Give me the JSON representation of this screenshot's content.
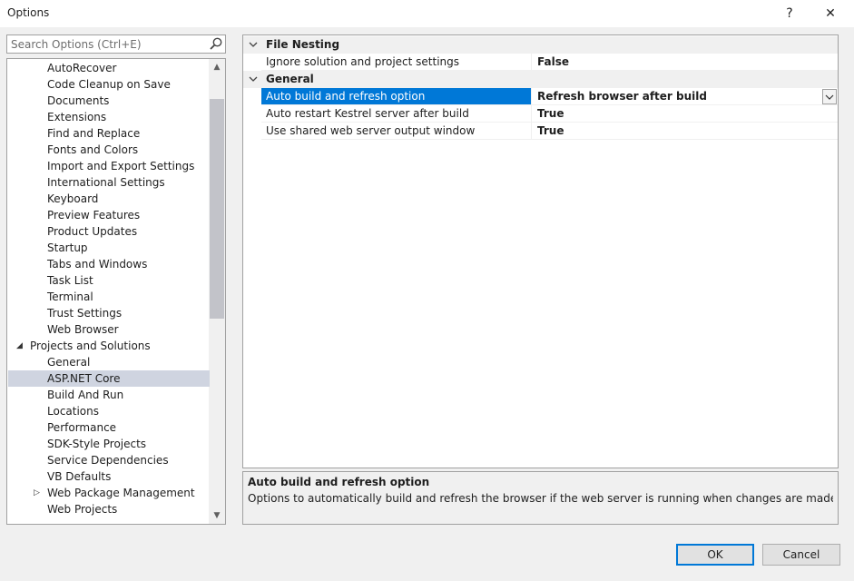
{
  "window": {
    "title": "Options",
    "help_label": "?",
    "close_label": "✕"
  },
  "search": {
    "placeholder": "Search Options (Ctrl+E)"
  },
  "tree": {
    "items": [
      {
        "label": "AutoRecover",
        "level": 2
      },
      {
        "label": "Code Cleanup on Save",
        "level": 2
      },
      {
        "label": "Documents",
        "level": 2
      },
      {
        "label": "Extensions",
        "level": 2
      },
      {
        "label": "Find and Replace",
        "level": 2
      },
      {
        "label": "Fonts and Colors",
        "level": 2
      },
      {
        "label": "Import and Export Settings",
        "level": 2
      },
      {
        "label": "International Settings",
        "level": 2
      },
      {
        "label": "Keyboard",
        "level": 2
      },
      {
        "label": "Preview Features",
        "level": 2
      },
      {
        "label": "Product Updates",
        "level": 2
      },
      {
        "label": "Startup",
        "level": 2
      },
      {
        "label": "Tabs and Windows",
        "level": 2
      },
      {
        "label": "Task List",
        "level": 2
      },
      {
        "label": "Terminal",
        "level": 2
      },
      {
        "label": "Trust Settings",
        "level": 2
      },
      {
        "label": "Web Browser",
        "level": 2
      },
      {
        "label": "Projects and Solutions",
        "level": 1,
        "expander": "◢"
      },
      {
        "label": "General",
        "level": 2
      },
      {
        "label": "ASP.NET Core",
        "level": 2,
        "selected": true
      },
      {
        "label": "Build And Run",
        "level": 2
      },
      {
        "label": "Locations",
        "level": 2
      },
      {
        "label": "Performance",
        "level": 2
      },
      {
        "label": "SDK-Style Projects",
        "level": 2
      },
      {
        "label": "Service Dependencies",
        "level": 2
      },
      {
        "label": "VB Defaults",
        "level": 2
      },
      {
        "label": "Web Package Management",
        "level": 2,
        "expander": "▷"
      },
      {
        "label": "Web Projects",
        "level": 2
      }
    ]
  },
  "grid": {
    "categories": [
      {
        "label": "File Nesting",
        "properties": [
          {
            "name": "Ignore solution and project settings",
            "value": "False"
          }
        ]
      },
      {
        "label": "General",
        "properties": [
          {
            "name": "Auto build and refresh option",
            "value": "Refresh browser after build",
            "selected": true,
            "dropdown": true
          },
          {
            "name": "Auto restart Kestrel server after build",
            "value": "True"
          },
          {
            "name": "Use shared web server output window",
            "value": "True"
          }
        ]
      }
    ]
  },
  "description": {
    "title": "Auto build and refresh option",
    "text": "Options to automatically build and refresh the browser if the web server is running when changes are made to the project"
  },
  "buttons": {
    "ok": "OK",
    "cancel": "Cancel"
  },
  "colors": {
    "selection": "#0078d7",
    "tree_selection": "#cfd4e0"
  }
}
